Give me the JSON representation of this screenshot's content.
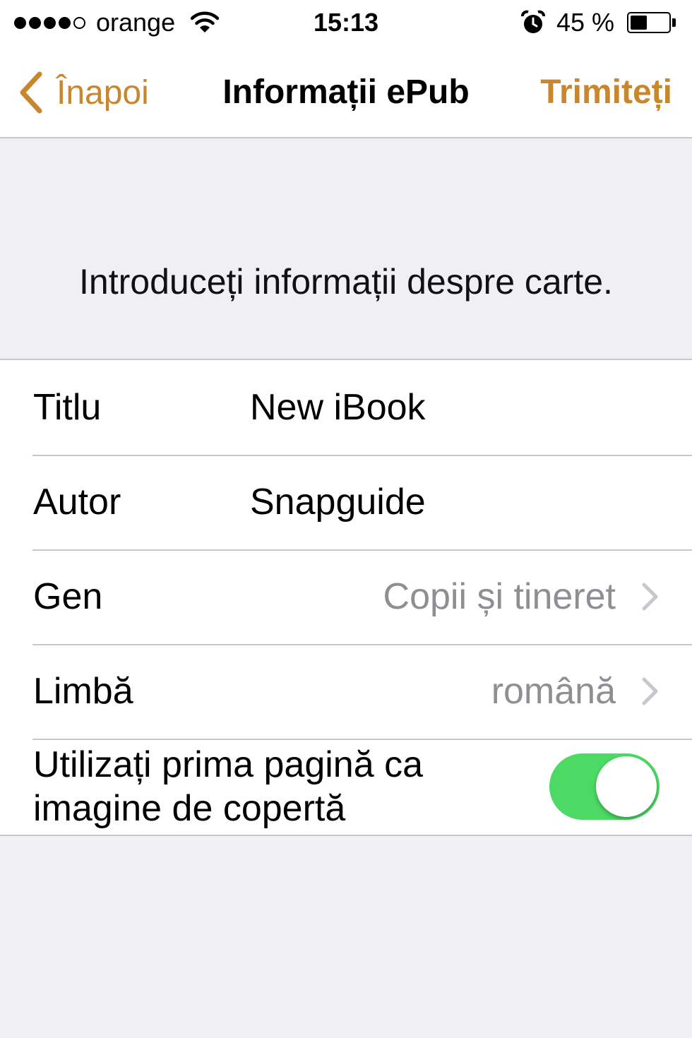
{
  "status_bar": {
    "carrier": "orange",
    "time": "15:13",
    "battery_label": "45 %",
    "battery_level": 0.45,
    "signal_bars_filled": 4,
    "signal_bars_total": 5,
    "icons": [
      "wifi-icon",
      "alarm-clock-icon",
      "battery-icon"
    ]
  },
  "nav": {
    "back_label": "Înapoi",
    "title": "Informații ePub",
    "send_label": "Trimiteți",
    "accent_color": "#c8872d"
  },
  "section": {
    "header": "Introduceți informații despre carte."
  },
  "form": {
    "title_label": "Titlu",
    "title_value": "New iBook",
    "author_label": "Autor",
    "author_value": "Snapguide",
    "genre_label": "Gen",
    "genre_value": "Copii și tineret",
    "language_label": "Limbă",
    "language_value": "română",
    "cover_label": "Utilizați prima pagină ca imagine de copertă",
    "cover_enabled": true,
    "toggle_color": "#4cd964"
  }
}
